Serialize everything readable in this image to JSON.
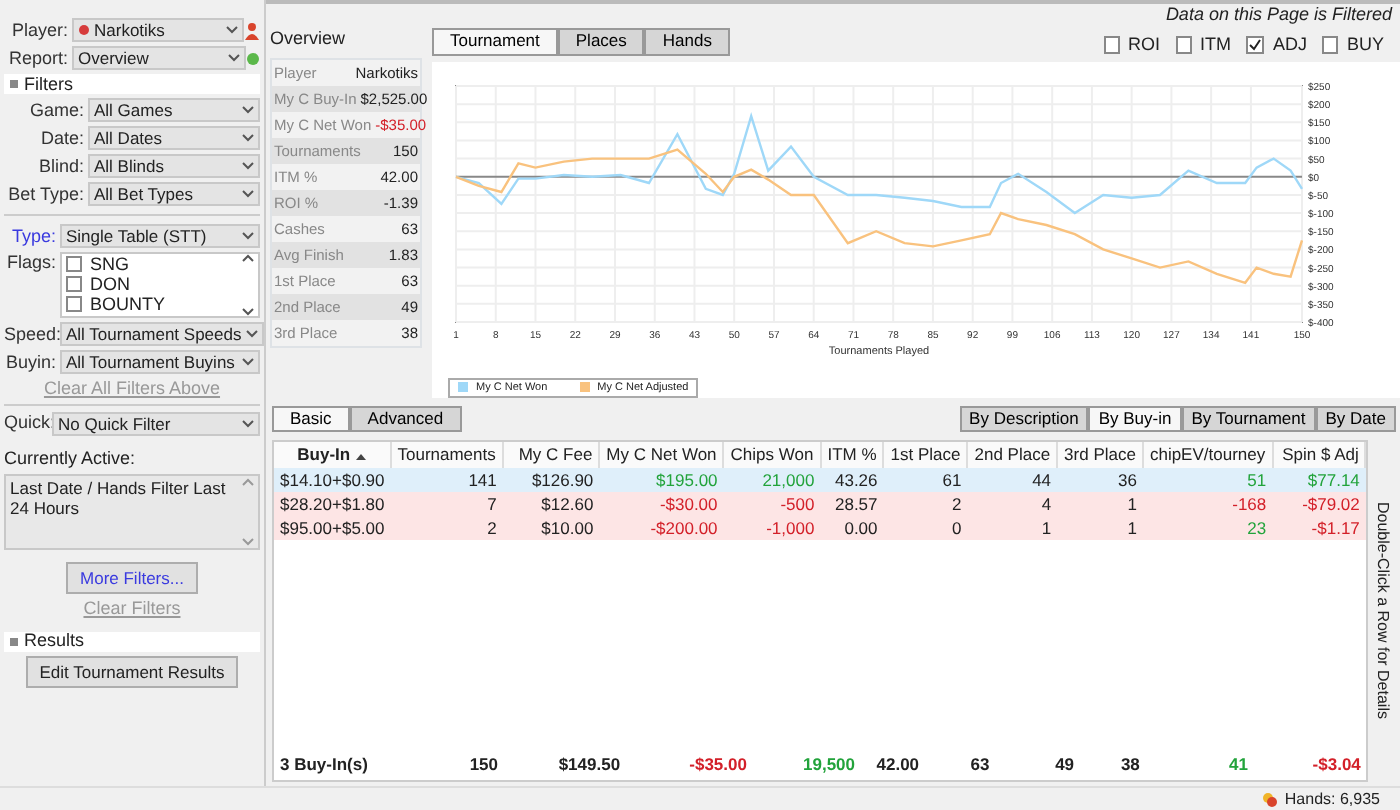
{
  "left_panel": {
    "player": {
      "label": "Player:",
      "value": "Narkotiks"
    },
    "report": {
      "label": "Report:",
      "value": "Overview"
    },
    "filters_header": "Filters",
    "filters": [
      {
        "label": "Game:",
        "value": "All Games"
      },
      {
        "label": "Date:",
        "value": "All Dates"
      },
      {
        "label": "Blind:",
        "value": "All Blinds"
      },
      {
        "label": "Bet Type:",
        "value": "All Bet Types"
      }
    ],
    "type": {
      "label": "Type:",
      "value": "Single Table (STT)"
    },
    "flags": {
      "label": "Flags:",
      "items": [
        {
          "label": "SNG",
          "checked": false
        },
        {
          "label": "DON",
          "checked": false
        },
        {
          "label": "BOUNTY",
          "checked": false
        }
      ]
    },
    "tournament_filters": [
      {
        "label": "Speed:",
        "value": "All Tournament Speeds"
      },
      {
        "label": "Buyin:",
        "value": "All Tournament Buyins"
      }
    ],
    "clear_all": "Clear All Filters Above",
    "quick": {
      "label": "Quick:",
      "value": "No Quick Filter"
    },
    "currently_active": {
      "label": "Currently Active:",
      "value": "Last Date / Hands Filter Last 24 Hours"
    },
    "more_filters": "More Filters...",
    "clear_filters": "Clear Filters",
    "results_header": "Results",
    "edit_results": "Edit Tournament Results"
  },
  "overview": {
    "title": "Overview",
    "rows": [
      {
        "label": "Player",
        "value": "Narkotiks"
      },
      {
        "label": "My C Buy-In",
        "value": "$2,525.00"
      },
      {
        "label": "My C Net Won",
        "value": "-$35.00",
        "color": "#d32029"
      },
      {
        "label": "Tournaments",
        "value": "150"
      },
      {
        "label": "ITM %",
        "value": "42.00"
      },
      {
        "label": "ROI %",
        "value": "-1.39"
      },
      {
        "label": "Cashes",
        "value": "63"
      },
      {
        "label": "Avg Finish",
        "value": "1.83"
      },
      {
        "label": "1st Place",
        "value": "63"
      },
      {
        "label": "2nd Place",
        "value": "49"
      },
      {
        "label": "3rd Place",
        "value": "38"
      }
    ]
  },
  "chart_panel": {
    "tabs": [
      {
        "label": "Tournament",
        "selected": true
      },
      {
        "label": "Places",
        "selected": false
      },
      {
        "label": "Hands",
        "selected": false
      }
    ],
    "filtered_note": "Data on this Page is Filtered",
    "options": [
      {
        "label": "ROI",
        "checked": false
      },
      {
        "label": "ITM",
        "checked": false
      },
      {
        "label": "ADJ",
        "checked": true
      },
      {
        "label": "BUY",
        "checked": false
      }
    ],
    "chart_data": {
      "type": "line",
      "xlabel": "Tournaments Played",
      "xlim": [
        1,
        150
      ],
      "ylim": [
        -400,
        250
      ],
      "grid": true,
      "x": [
        1,
        5,
        9,
        12,
        15,
        20,
        25,
        30,
        35,
        40,
        45,
        48,
        50,
        53,
        56,
        60,
        64,
        70,
        75,
        80,
        85,
        90,
        95,
        97,
        100,
        105,
        110,
        115,
        120,
        125,
        130,
        135,
        140,
        142,
        145,
        148,
        150
      ],
      "series": [
        {
          "name": "My C Net Won",
          "color": "#9fd8f8",
          "values": [
            0,
            -17,
            -75,
            -5,
            -5,
            5,
            0,
            5,
            -17,
            117,
            -33,
            -50,
            8,
            167,
            17,
            83,
            0,
            -50,
            -50,
            -58,
            -67,
            -83,
            -83,
            -17,
            8,
            -42,
            -100,
            -50,
            -58,
            -50,
            17,
            -17,
            -17,
            25,
            50,
            17,
            -33
          ]
        },
        {
          "name": "My C Net Adjusted",
          "color": "#f9c27e",
          "values": [
            0,
            -25,
            -42,
            37,
            25,
            42,
            50,
            50,
            50,
            75,
            8,
            -42,
            0,
            20,
            -8,
            -50,
            -50,
            -183,
            -150,
            -183,
            -192,
            -175,
            -158,
            -100,
            -117,
            -133,
            -158,
            -200,
            -225,
            -250,
            -233,
            -267,
            -292,
            -250,
            -267,
            -275,
            -175
          ]
        }
      ],
      "xticks": [
        1,
        8,
        15,
        22,
        29,
        36,
        43,
        50,
        57,
        64,
        71,
        78,
        85,
        92,
        99,
        106,
        113,
        120,
        127,
        134,
        141,
        150
      ],
      "yticks": [
        {
          "value": 250,
          "label": "$250"
        },
        {
          "value": 200,
          "label": "$200"
        },
        {
          "value": 150,
          "label": "$150"
        },
        {
          "value": 100,
          "label": "$100"
        },
        {
          "value": 50,
          "label": "$50"
        },
        {
          "value": 0,
          "label": "$0"
        },
        {
          "value": -50,
          "label": "$-50"
        },
        {
          "value": -100,
          "label": "$-100"
        },
        {
          "value": -150,
          "label": "$-150"
        },
        {
          "value": -200,
          "label": "$-200"
        },
        {
          "value": -250,
          "label": "$-250"
        },
        {
          "value": -300,
          "label": "$-300"
        },
        {
          "value": -350,
          "label": "$-350"
        },
        {
          "value": -400,
          "label": "$-400"
        }
      ]
    }
  },
  "results": {
    "view_tabs": [
      {
        "label": "Basic",
        "selected": true
      },
      {
        "label": "Advanced",
        "selected": false
      }
    ],
    "group_tabs": [
      {
        "label": "By Description",
        "selected": false
      },
      {
        "label": "By Buy-in",
        "selected": true
      },
      {
        "label": "By Tournament",
        "selected": false
      },
      {
        "label": "By Date",
        "selected": false
      }
    ],
    "table": {
      "columns": [
        {
          "label": "Buy-In",
          "sorted": true
        },
        {
          "label": "Tournaments",
          "sorted": false
        },
        {
          "label": "My C Fee",
          "sorted": false
        },
        {
          "label": "My C Net Won",
          "sorted": false
        },
        {
          "label": "Chips Won",
          "sorted": false
        },
        {
          "label": "ITM %",
          "sorted": false
        },
        {
          "label": "1st Place",
          "sorted": false
        },
        {
          "label": "2nd Place",
          "sorted": false
        },
        {
          "label": "3rd Place",
          "sorted": false
        },
        {
          "label": "chipEV/tourney",
          "sorted": false
        },
        {
          "label": "Spin $ Adj",
          "sorted": false
        }
      ],
      "rows": [
        {
          "color": "#dfeffa",
          "cells": [
            {
              "text": "$14.10+$0.90"
            },
            {
              "text": "141"
            },
            {
              "text": "$126.90"
            },
            {
              "text": "$195.00",
              "color": "#22a33b"
            },
            {
              "text": "21,000",
              "color": "#22a33b"
            },
            {
              "text": "43.26"
            },
            {
              "text": "61"
            },
            {
              "text": "44"
            },
            {
              "text": "36"
            },
            {
              "text": "51",
              "color": "#22a33b"
            },
            {
              "text": "$77.14",
              "color": "#22a33b"
            }
          ]
        },
        {
          "color": "#fde5e5",
          "cells": [
            {
              "text": "$28.20+$1.80"
            },
            {
              "text": "7"
            },
            {
              "text": "$12.60"
            },
            {
              "text": "-$30.00",
              "color": "#d32029"
            },
            {
              "text": "-500",
              "color": "#d32029"
            },
            {
              "text": "28.57"
            },
            {
              "text": "2"
            },
            {
              "text": "4"
            },
            {
              "text": "1"
            },
            {
              "text": "-168",
              "color": "#d32029"
            },
            {
              "text": "-$79.02",
              "color": "#d32029"
            }
          ]
        },
        {
          "color": "#fde5e5",
          "cells": [
            {
              "text": "$95.00+$5.00"
            },
            {
              "text": "2"
            },
            {
              "text": "$10.00"
            },
            {
              "text": "-$200.00",
              "color": "#d32029"
            },
            {
              "text": "-1,000",
              "color": "#d32029"
            },
            {
              "text": "0.00"
            },
            {
              "text": "0"
            },
            {
              "text": "1"
            },
            {
              "text": "1"
            },
            {
              "text": "23",
              "color": "#22a33b"
            },
            {
              "text": "-$1.17",
              "color": "#d32029"
            }
          ]
        }
      ],
      "totals": [
        {
          "text": "3 Buy-In(s)"
        },
        {
          "text": "150"
        },
        {
          "text": "$149.50"
        },
        {
          "text": "-$35.00",
          "color": "#d32029"
        },
        {
          "text": "19,500",
          "color": "#22a33b"
        },
        {
          "text": "42.00"
        },
        {
          "text": "63"
        },
        {
          "text": "49"
        },
        {
          "text": "38"
        },
        {
          "text": "41",
          "color": "#22a33b"
        },
        {
          "text": "-$3.04",
          "color": "#d32029"
        }
      ]
    },
    "hint": "Double-Click a Row for Details"
  },
  "status_bar": {
    "hands": "Hands: 6,935"
  }
}
